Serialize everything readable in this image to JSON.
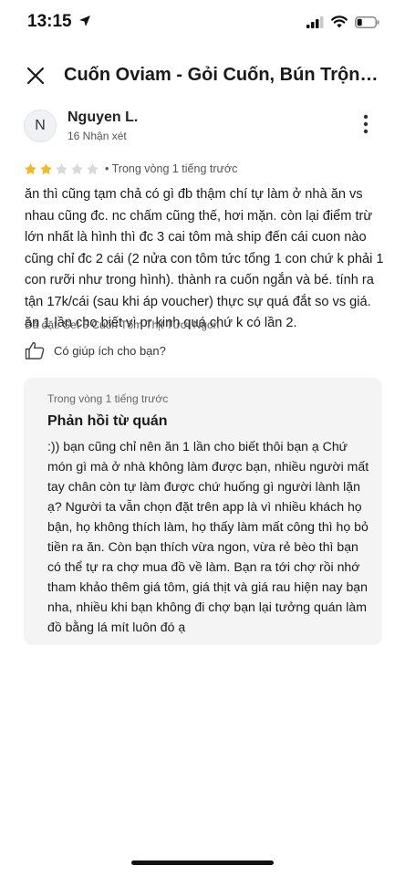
{
  "status_bar": {
    "time": "13:15"
  },
  "header": {
    "title": "Cuốn Oviam - Gỏi Cuốn, Bún Trộn, G..."
  },
  "review": {
    "avatar_initial": "N",
    "reviewer_name": "Nguyen L.",
    "review_count": "16 Nhận xét",
    "rating": 2,
    "rating_max": 5,
    "time_ago": "• Trong vòng 1 tiếng trước",
    "text": "ăn thì cũng tạm chả có gì đb thậm chí tự làm ở nhà ăn vs nhau cũng đc. nc chấm cũng thế, hơi mặn. còn lại điểm trừ lớn nhất là hình thì đc 3 cai tôm mà ship đến cái cuon nào cũng chỉ đc 2 cái (2 nửa con tôm tức tổng 1 con chứ k phải 1 con rưỡi như trong hình). thành ra cuốn ngắn và bé. tính ra tận 17k/cái (sau khi áp voucher) thực sự quá đắt so vs giá. ăn 1 lần cho biết vì pr kinh quá chứ k có lần 2.",
    "ordered_item": "Đã đặt: Set 5 Cuốn Tôm Thịt Tươi Ngon",
    "helpful_label": "Có giúp ích cho bạn?"
  },
  "reply": {
    "time_ago": "Trong vòng 1 tiếng trước",
    "title": "Phản hồi từ quán",
    "text": ":)) bạn cũng chỉ nên ăn 1 lần cho biết thôi bạn ạ Chứ món gì mà ở nhà không làm được bạn, nhiều người mất tay chân còn tự làm được chứ huống gì người lành lặn ạ? Người ta vẫn chọn đặt trên app là vì nhiều khách họ bận, họ không thích làm, họ thấy làm mất công thì họ bỏ tiền ra ăn. Còn bạn thích vừa ngon, vừa rẻ bèo thì bạn có thể tự ra chợ mua đồ về làm. Bạn ra tới chợ rồi nhớ tham khảo thêm giá tôm, giá thịt và giá rau hiện nay bạn nha, nhiều khi bạn không đi chợ bạn lại tưởng quán làm đồ bằng lá mít luôn đó ạ"
  },
  "icons": {
    "location": "location-arrow-icon",
    "signal": "cellular-signal-icon",
    "wifi": "wifi-icon",
    "battery": "battery-icon",
    "close": "close-icon",
    "more": "more-vertical-icon",
    "thumb": "thumbs-up-icon",
    "star": "star-icon"
  },
  "colors": {
    "star_filled": "#F6B81B",
    "star_empty": "#D9D9D9",
    "reply_bg": "#F4F4F5"
  }
}
